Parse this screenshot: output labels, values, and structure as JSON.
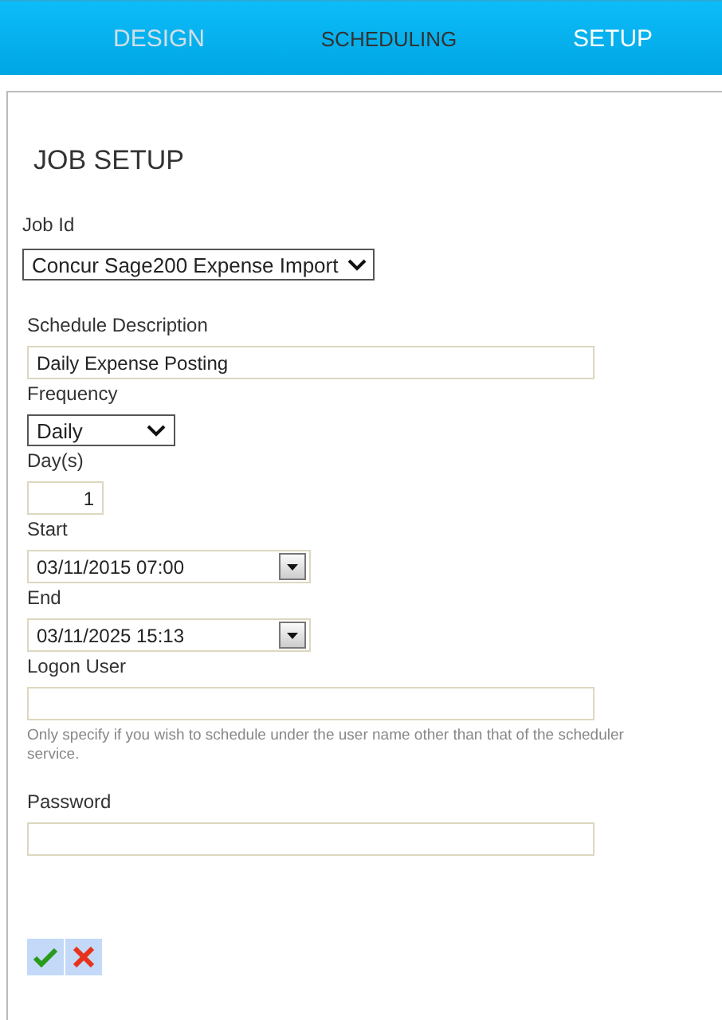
{
  "tabs": [
    {
      "label": "DESIGN",
      "selected": false,
      "disabled": true
    },
    {
      "label": "SCHEDULING",
      "selected": true,
      "disabled": false
    },
    {
      "label": "SETUP",
      "selected": false,
      "disabled": false
    }
  ],
  "heading": "JOB SETUP",
  "job_id": {
    "label": "Job Id",
    "value": "Concur Sage200 Expense Import"
  },
  "fields": [
    {
      "kind": "text",
      "label": "Schedule Description",
      "value": "Daily Expense Posting"
    },
    {
      "kind": "select",
      "label": "Frequency",
      "value": "Daily"
    },
    {
      "kind": "number",
      "label": "Day(s)",
      "value": "1"
    },
    {
      "kind": "datetime",
      "label": "Start",
      "value": "03/11/2015 07:00"
    },
    {
      "kind": "datetime",
      "label": "End",
      "value": "03/11/2025 15:13"
    },
    {
      "kind": "text",
      "label": "Logon User",
      "hint": "Only specify if you wish to schedule under the user name other than that of the scheduler service."
    },
    {
      "kind": "password",
      "label": "Password"
    }
  ],
  "actions": [
    {
      "kind": "ok"
    },
    {
      "kind": "cancel"
    }
  ]
}
